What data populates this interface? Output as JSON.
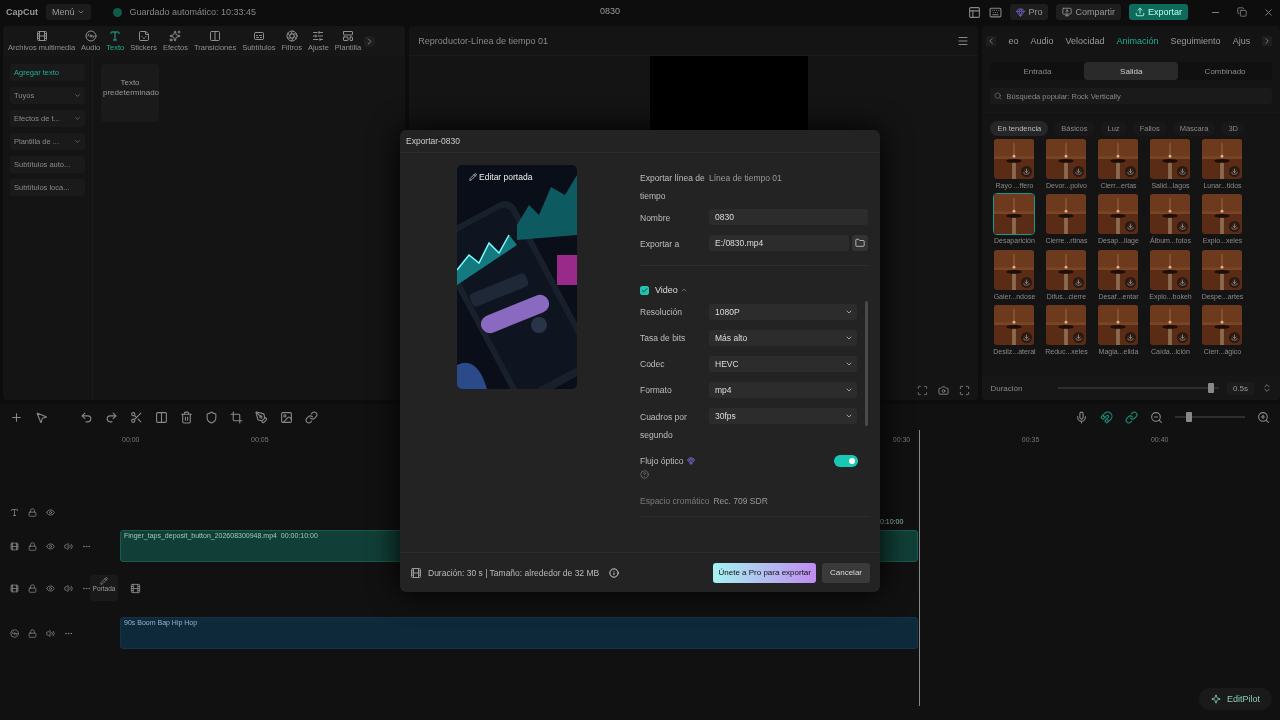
{
  "app_bar": {
    "logo": "CapCut",
    "menu": "Menú",
    "autosave": "Guardado automático: 10:33:45",
    "title": "0830",
    "pro": "Pro",
    "share": "Compartir",
    "export": "Exportar"
  },
  "media_panel": {
    "tabs": [
      {
        "label": "Archivos multimedia",
        "selected": false
      },
      {
        "label": "Audio",
        "selected": false
      },
      {
        "label": "Texto",
        "selected": true
      },
      {
        "label": "Stickers",
        "selected": false
      },
      {
        "label": "Efectos",
        "selected": false
      },
      {
        "label": "Transiciones",
        "selected": false
      },
      {
        "label": "Subtítulos",
        "selected": false
      },
      {
        "label": "Filtros",
        "selected": false
      },
      {
        "label": "Ajuste",
        "selected": false
      },
      {
        "label": "Plantilla",
        "selected": false
      }
    ],
    "sidebar": [
      {
        "label": "Agregar texto",
        "selected": true,
        "dropdown": false
      },
      {
        "label": "Tuyos",
        "selected": false,
        "dropdown": true
      },
      {
        "label": "Efectos de t...",
        "selected": false,
        "dropdown": true
      },
      {
        "label": "Plantilla de ...",
        "selected": false,
        "dropdown": true
      },
      {
        "label": "Subtítulos auto...",
        "selected": false,
        "dropdown": false
      },
      {
        "label": "Subtítulos loca...",
        "selected": false,
        "dropdown": false
      }
    ],
    "presets": [
      "Texto predeterminado"
    ]
  },
  "player": {
    "title": "Reproductor-Línea de tiempo 01"
  },
  "inspector": {
    "tabs": [
      {
        "label": "eo",
        "selected": false
      },
      {
        "label": "Audio",
        "selected": false
      },
      {
        "label": "Velocidad",
        "selected": false
      },
      {
        "label": "Animación",
        "selected": true
      },
      {
        "label": "Seguimiento",
        "selected": false
      },
      {
        "label": "Ajus",
        "selected": false
      }
    ],
    "modes": [
      {
        "label": "Entrada",
        "selected": false
      },
      {
        "label": "Salida",
        "selected": true
      },
      {
        "label": "Combinado",
        "selected": false
      }
    ],
    "search": {
      "placeholder": "Búsqueda popular: Rock Vertically"
    },
    "categories": [
      {
        "label": "En tendencia",
        "selected": true
      },
      {
        "label": "Básicos",
        "selected": false
      },
      {
        "label": "Luz",
        "selected": false
      },
      {
        "label": "Fallos",
        "selected": false
      },
      {
        "label": "Máscara",
        "selected": false
      },
      {
        "label": "3D",
        "selected": false
      }
    ],
    "effects": [
      {
        "label": "Rayo ...ffero",
        "selected": false,
        "download": true
      },
      {
        "label": "Devor...polvo",
        "selected": false,
        "download": true
      },
      {
        "label": "Cierr...ertas",
        "selected": false,
        "download": true
      },
      {
        "label": "Salid...lagos",
        "selected": false,
        "download": true
      },
      {
        "label": "Lunar...tidos",
        "selected": false,
        "download": true
      },
      {
        "label": "Desaparición",
        "selected": true,
        "download": false
      },
      {
        "label": "Cierre...rtinas",
        "selected": false,
        "download": false
      },
      {
        "label": "Desap...llage",
        "selected": false,
        "download": true
      },
      {
        "label": "Álbum...fotos",
        "selected": false,
        "download": true
      },
      {
        "label": "Explo...xeles",
        "selected": false,
        "download": true
      },
      {
        "label": "Galer...ndose",
        "selected": false,
        "download": true
      },
      {
        "label": "Difus...cierre",
        "selected": false,
        "download": true
      },
      {
        "label": "Desaf...entar",
        "selected": false,
        "download": true
      },
      {
        "label": "Explo...bokeh",
        "selected": false,
        "download": true
      },
      {
        "label": "Despe...artes",
        "selected": false,
        "download": true
      },
      {
        "label": "Desliz...ateral",
        "selected": false,
        "download": true
      },
      {
        "label": "Reduc...xeles",
        "selected": false,
        "download": true
      },
      {
        "label": "Magia...elida",
        "selected": false,
        "download": true
      },
      {
        "label": "Caída...ición",
        "selected": false,
        "download": true
      },
      {
        "label": "Cierr...ágico",
        "selected": false,
        "download": true
      }
    ],
    "duration": {
      "label": "Duración",
      "level": 0.95,
      "value": "0.5s"
    }
  },
  "timeline": {
    "ruler": [
      "00:00",
      "00:05",
      "00:30",
      "00:35",
      "00:40"
    ],
    "zoom": {
      "level": 0.2
    },
    "video_clip": {
      "name": "Finger_taps_deposit_button_202608300948.mp4",
      "duration": "00:00:10:00",
      "end": "0:10:00"
    },
    "cover": "Portada",
    "audio_clip": "90s Boom Bap Hip Hop",
    "assistant": "EditPilot"
  },
  "export_dialog": {
    "title": "Exportar-0830",
    "edit_cover": "Editar portada",
    "timeline_label": "Exportar línea de tiempo",
    "timeline_value": "Línea de tiempo 01",
    "name_label": "Nombre",
    "name_value": "0830",
    "path_label": "Exportar a",
    "path_value": "E:/0830.mp4",
    "video": {
      "label": "Video",
      "checked": true
    },
    "settings": [
      {
        "label": "Resolución",
        "value": "1080P"
      },
      {
        "label": "Tasa de bits",
        "value": "Más alto"
      },
      {
        "label": "Codec",
        "value": "HEVC"
      },
      {
        "label": "Formato",
        "value": "mp4"
      },
      {
        "label": "Cuadros por segundo",
        "value": "30fps"
      }
    ],
    "optical_flow": {
      "label": "Flujo óptico",
      "on": true
    },
    "color_space": {
      "label": "Espacio cromático",
      "value": "Rec. 709 SDR"
    },
    "summary": "Duración: 30 s | Tamaño: alrededor de 32 MB",
    "primary": "Únete a Pro para exportar",
    "cancel": "Cancelar"
  }
}
